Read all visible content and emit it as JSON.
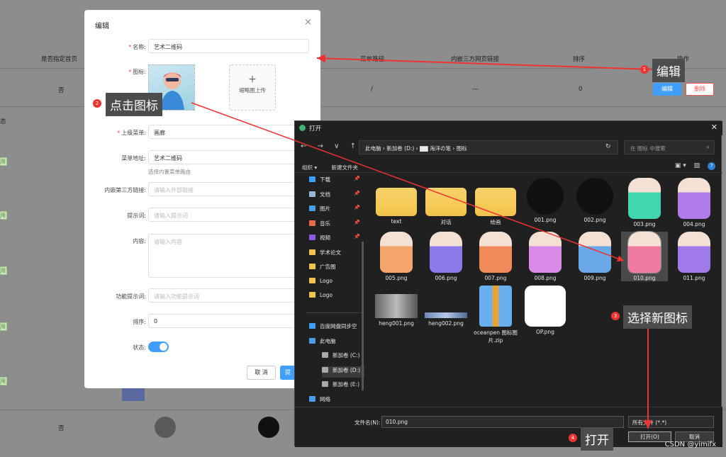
{
  "background": {
    "headers": [
      "是否指定首页",
      "菜单路径",
      "内嵌三方网页链接",
      "排序",
      "操作"
    ],
    "row": {
      "home": "否",
      "path": "/",
      "link": "---",
      "sort": "0",
      "edit": "编辑",
      "delete": "删除"
    },
    "row2": {
      "home": "否"
    },
    "status_label": "态",
    "tag": "用"
  },
  "dialog": {
    "title": "编辑",
    "close": "×",
    "name_label": "名称:",
    "name_value": "艺术二维码",
    "icon_label": "图标:",
    "thumb_upload": "缩略图上传",
    "plus": "+",
    "parent_label": "上级菜单:",
    "parent_value": "画廊",
    "menu_addr_label": "菜单地址:",
    "menu_addr_value": "艺术二维码",
    "menu_addr_hint": "选择内置菜单路由",
    "embed_label": "内嵌第三方链接:",
    "embed_placeholder": "请输入外部链接",
    "prompt_label": "提示词:",
    "prompt_placeholder": "请输入提示词",
    "content_label": "内容:",
    "content_placeholder": "请输入内容",
    "func_prompt_label": "功能提示词:",
    "func_prompt_placeholder": "请输入功能提示词",
    "sort_label": "排序:",
    "sort_value": "0",
    "status_label": "状态:",
    "cancel": "取 消",
    "confirm": "提"
  },
  "explorer": {
    "title": "打开",
    "close": "✕",
    "nav": "← → ∨ ↑",
    "address": "此电脑 › 新加卷 (D:) ›  ▇▇  海洋の笔 › 图标",
    "refresh": "↻",
    "search_placeholder": "在 图标 中搜索",
    "organize": "组织 ▾",
    "new_folder": "新建文件夹",
    "sidebar": [
      {
        "label": "下载",
        "color": "#3ca0ff",
        "pin": true
      },
      {
        "label": "文档",
        "color": "#9bb5d8",
        "pin": true
      },
      {
        "label": "图片",
        "color": "#4a9de8",
        "pin": true
      },
      {
        "label": "音乐",
        "color": "#e86a4a",
        "pin": true
      },
      {
        "label": "视频",
        "color": "#8a5ae8",
        "pin": true
      },
      {
        "label": "学术论文",
        "color": "#f2c44a",
        "pin": false
      },
      {
        "label": "广告图",
        "color": "#f2c44a",
        "pin": false
      },
      {
        "label": "Logo",
        "color": "#f2c44a",
        "pin": false
      },
      {
        "label": "Logo",
        "color": "#f2c44a",
        "pin": false
      }
    ],
    "sidebar2": [
      {
        "label": "百度网盘同步空",
        "color": "#3ca0ff"
      },
      {
        "label": "此电脑",
        "color": "#4a9de8"
      },
      {
        "label": "新加卷 (C:)",
        "color": "#aaa"
      },
      {
        "label": "新加卷 (D:)",
        "color": "#aaa"
      },
      {
        "label": "新加卷 (E:)",
        "color": "#aaa"
      },
      {
        "label": "网络",
        "color": "#4a9de8"
      }
    ],
    "files": [
      {
        "name": "text",
        "kind": "folder"
      },
      {
        "name": "对话",
        "kind": "folder"
      },
      {
        "name": "绘画",
        "kind": "folder"
      },
      {
        "name": "001.png",
        "kind": "black"
      },
      {
        "name": "002.png",
        "kind": "black"
      },
      {
        "name": "003.png",
        "kind": "char",
        "color": "#3fd6b0"
      },
      {
        "name": "004.png",
        "kind": "char",
        "color": "#b07be8"
      },
      {
        "name": "005.png",
        "kind": "char",
        "color": "#f4a56a"
      },
      {
        "name": "006.png",
        "kind": "char",
        "color": "#8a7be8"
      },
      {
        "name": "007.png",
        "kind": "char",
        "color": "#f08a5a"
      },
      {
        "name": "008.png",
        "kind": "char",
        "color": "#d88ae8"
      },
      {
        "name": "009.png",
        "kind": "char",
        "color": "#6aa8e8"
      },
      {
        "name": "010.png",
        "kind": "char",
        "color": "#f07aa0"
      },
      {
        "name": "011.png",
        "kind": "char",
        "color": "#a07ae8"
      },
      {
        "name": "heng001.png",
        "kind": "photo"
      },
      {
        "name": "heng002.png",
        "kind": "strip"
      },
      {
        "name": "oceanpen 图标图片.zip",
        "kind": "zip"
      },
      {
        "name": "OP.png",
        "kind": "op"
      }
    ],
    "filename_label": "文件名(N):",
    "filename_value": "010.png",
    "filetype": "所有文件 (*.*)",
    "open": "打开(O)",
    "cancel": "取消"
  },
  "callouts": {
    "c1": {
      "num": "1",
      "text": "编辑"
    },
    "c2": {
      "num": "2",
      "text": "点击图标"
    },
    "c3": {
      "num": "3",
      "text": "选择新图标"
    },
    "c4": {
      "num": "4",
      "text": "打开"
    }
  },
  "watermark": "CSDN @yimifx",
  "colors": {
    "primary": "#409eff",
    "danger": "#e55555",
    "explorer_bg": "#202020",
    "callout_red": "#e33333"
  }
}
